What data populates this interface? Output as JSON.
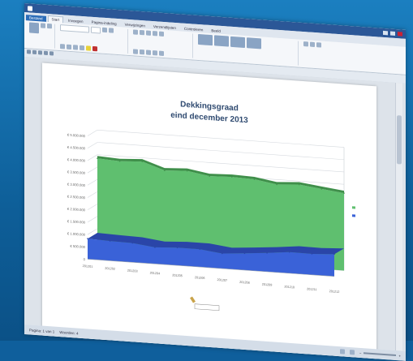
{
  "window": {
    "title": "",
    "file_tab": "Bestand"
  },
  "ribbon_tabs": [
    "Start",
    "Invoegen",
    "Pagina-indeling",
    "Verwijzingen",
    "Verzendlijsten",
    "Controleren",
    "Beeld"
  ],
  "chart_data": {
    "type": "area",
    "title": "Dekkingsgraad\neind december 2013",
    "title_lines": [
      "Dekkingsgraad",
      "eind december 2013"
    ],
    "categories": [
      "201201",
      "201202",
      "201203",
      "201204",
      "201205",
      "201206",
      "201207",
      "201208",
      "201209",
      "201210",
      "201211",
      "201212"
    ],
    "series": [
      {
        "values": [
          3850000,
          3800000,
          3850000,
          3550000,
          3600000,
          3450000,
          3480000,
          3450000,
          3300000,
          3360000,
          3250000,
          3140000
        ],
        "color": "#5fbf6f"
      },
      {
        "values": [
          830000,
          800000,
          780000,
          670000,
          720000,
          720000,
          610000,
          680000,
          760000,
          860000,
          850000,
          900000
        ],
        "color": "#3a62d8"
      }
    ],
    "yticks": [
      "0",
      "€ 500.000",
      "€ 1.000.000",
      "€ 1.500.000",
      "€ 2.000.000",
      "€ 2.500.000",
      "€ 3.000.000",
      "€ 3.500.000",
      "€ 4.000.000",
      "€ 4.500.000",
      "€ 5.000.000"
    ],
    "ylim": [
      0,
      5000000
    ],
    "legend_position": "right",
    "grid": true
  },
  "statusbar": {
    "page_info": "Pagina: 1 van 1",
    "word_count": "Woorden: 4"
  }
}
